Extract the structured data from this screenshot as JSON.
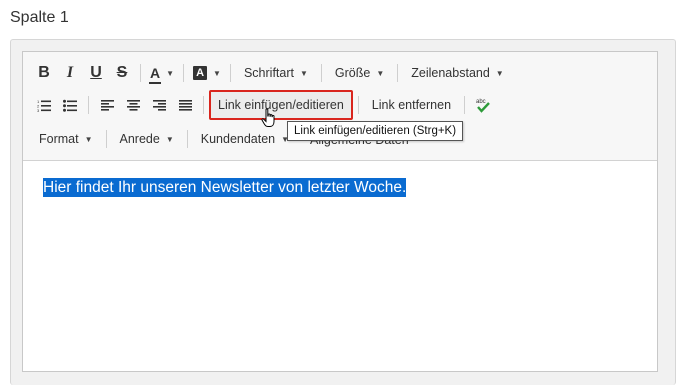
{
  "section": {
    "title": "Spalte 1"
  },
  "toolbar": {
    "row1": {
      "bold": "B",
      "italic": "I",
      "underline": "U",
      "strike": "S",
      "font_color": "A",
      "bg_color": "A",
      "font_family": "Schriftart",
      "font_size": "Größe",
      "line_height": "Zeilenabstand"
    },
    "row2": {
      "insert_link": "Link einfügen/editieren",
      "remove_link": "Link entfernen"
    },
    "row3": {
      "format": "Format",
      "salutation": "Anrede",
      "customer_data": "Kundendaten",
      "general_data": "Allgemeine Daten"
    },
    "tooltip": "Link einfügen/editieren (Strg+K)"
  },
  "editor": {
    "text": "Hier findet Ihr unseren Newsletter von letzter Woche."
  },
  "colors": {
    "selection": "#0a6bd1",
    "active_border": "#d9251d",
    "spellcheck": "#2e9b3a"
  }
}
